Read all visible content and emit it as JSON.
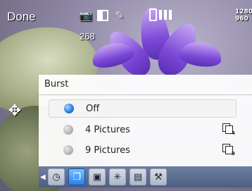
{
  "statusbar": {
    "done_label": "Done",
    "shots_remaining": "268",
    "icons": [
      "camera-icon",
      "exposure-icon",
      "edit-icon"
    ],
    "storage_icon": "phone-memory-icon",
    "resolution_line1": "1280",
    "resolution_line2": "960"
  },
  "navigation": {
    "icon": "navigation-pad-icon"
  },
  "burst_menu": {
    "title": "Burst",
    "options": [
      {
        "label": "Off",
        "selected": true
      },
      {
        "label": "4 Pictures",
        "selected": false,
        "icon": "burst-4-icon",
        "icon_num": "4"
      },
      {
        "label": "9 Pictures",
        "selected": false,
        "icon": "burst-9-icon",
        "icon_num": "9"
      }
    ]
  },
  "toolbar": {
    "items": [
      {
        "icon": "self-timer-icon",
        "glyph": "◷",
        "active": false
      },
      {
        "icon": "burst-mode-icon",
        "glyph": "❐",
        "active": true
      },
      {
        "icon": "frame-icon",
        "glyph": "▣",
        "active": false
      },
      {
        "icon": "effects-icon",
        "glyph": "✳",
        "active": false
      },
      {
        "icon": "scene-icon",
        "glyph": "▤",
        "active": false
      },
      {
        "icon": "settings-tools-icon",
        "glyph": "⚒",
        "active": false
      }
    ]
  },
  "colors": {
    "accent": "#2a7fe6",
    "radio_selected": "#2f7ee0",
    "toolbar_bg": "#4e5e82",
    "panel_bg": "#ffffff"
  }
}
